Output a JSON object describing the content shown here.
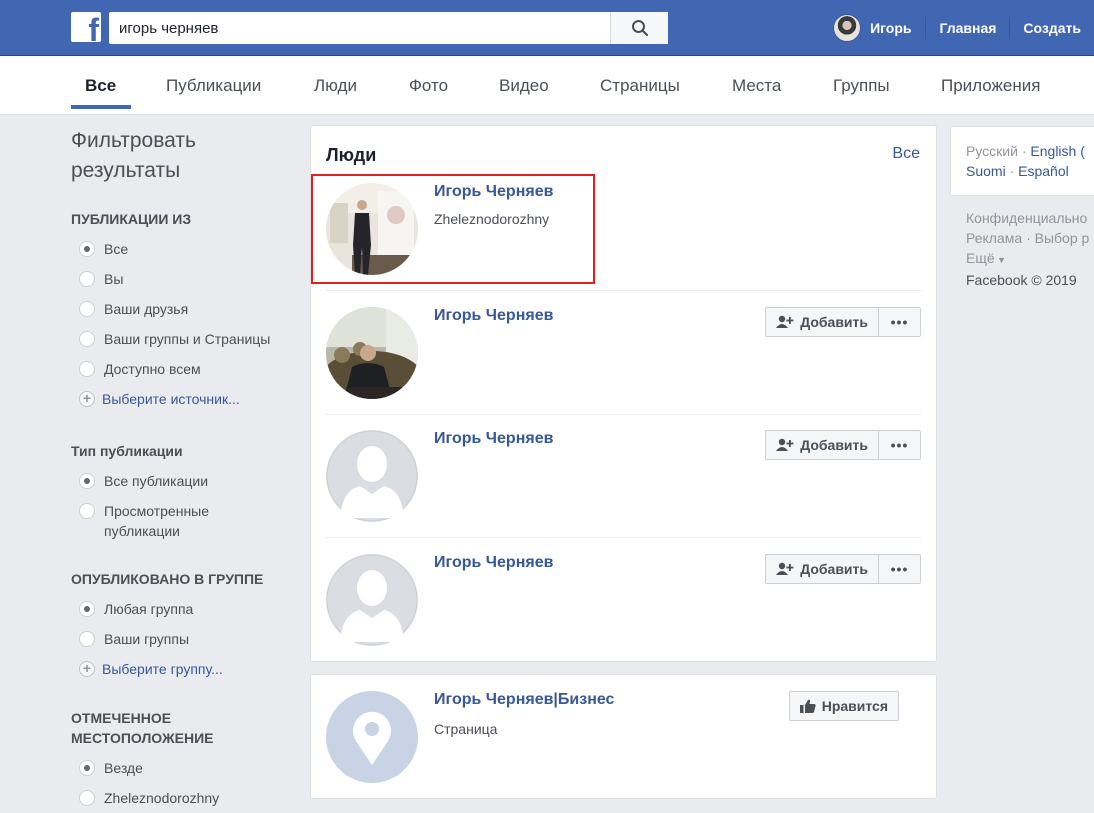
{
  "header": {
    "search_value": "игорь черняев",
    "profile_name": "Игорь",
    "links": [
      "Главная",
      "Создать"
    ]
  },
  "tabs": [
    "Все",
    "Публикации",
    "Люди",
    "Фото",
    "Видео",
    "Страницы",
    "Места",
    "Группы",
    "Приложения"
  ],
  "filters": {
    "title_line1": "Фильтровать",
    "title_line2": "результаты",
    "sections": [
      {
        "heading": "ПУБЛИКАЦИИ ИЗ",
        "options": [
          "Все",
          "Вы",
          "Ваши друзья",
          "Ваши группы и Страницы",
          "Доступно всем"
        ],
        "selected": 0,
        "more": "Выберите источник..."
      },
      {
        "heading": "Тип публикации",
        "options": [
          "Все публикации",
          "Просмотренные публикации"
        ],
        "selected": 0
      },
      {
        "heading": "ОПУБЛИКОВАНО В ГРУППЕ",
        "options": [
          "Любая группа",
          "Ваши группы"
        ],
        "selected": 0,
        "more": "Выберите группу..."
      },
      {
        "heading_line1": "ОТМЕЧЕННОЕ",
        "heading_line2": "МЕСТОПОЛОЖЕНИЕ",
        "options": [
          "Везде",
          "Zheleznodorozhny"
        ],
        "selected": 0
      }
    ]
  },
  "people": {
    "heading": "Люди",
    "see_all": "Все",
    "results": [
      {
        "name": "Игорь Черняев",
        "subtitle": "Zheleznodorozhny",
        "avatar": "photo-event",
        "has_add": false
      },
      {
        "name": "Игорь Черняев",
        "subtitle": "",
        "avatar": "photo-sofa",
        "has_add": true
      },
      {
        "name": "Игорь Черняев",
        "subtitle": "",
        "avatar": "default-silhouette",
        "has_add": true
      },
      {
        "name": "Игорь Черняев",
        "subtitle": "",
        "avatar": "default-silhouette",
        "has_add": true
      }
    ],
    "add_label": "Добавить",
    "more_label": "•••"
  },
  "page_result": {
    "name": "Игорь Черняев|Бизнес",
    "subtitle": "Страница",
    "like_label": "Нравится",
    "avatar": "place-pin"
  },
  "right": {
    "lang_current": "Русский",
    "langs": [
      "English (",
      "Suomi",
      "Español"
    ],
    "footer_line1": "Конфиденциально",
    "footer_line2a": "Реклама",
    "footer_line2b": "Выбор р",
    "footer_line3": "Ещё",
    "copyright": "Facebook © 2019"
  },
  "colors": {
    "brand": "#4267b2",
    "link": "#365899",
    "highlight": "#e02020"
  }
}
